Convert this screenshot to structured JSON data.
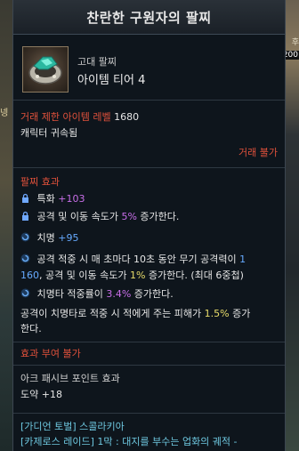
{
  "background": {
    "right_edge_text": "후",
    "right_edge_num": "200",
    "left_edge_label": "넹"
  },
  "tooltip": {
    "title": "찬란한 구원자의 팔찌",
    "grade": "고대 팔찌",
    "tier": "아이템 티어 4",
    "level_label": "거래 제한 아이템 레벨",
    "level_value": "1680",
    "bound": "캐릭터 귀속됨",
    "trade": "거래 불가",
    "effect_header": "팔찌 효과",
    "effects": {
      "e1_name": "특화",
      "e1_value": "+103",
      "e2_text": "공격 및 이동 속도가",
      "e2_value": "5%",
      "e2_suffix": "증가한다.",
      "e3_name": "치명",
      "e3_value": "+95",
      "e4_line1_a": "공격 적중 시 매 초마다 10초 동안 무기 공격력이",
      "e4_line1_b": "1",
      "e4_line2_a": "160",
      "e4_line2_b": ", 공격 및 이동 속도가",
      "e4_line2_c": "1%",
      "e4_line2_d": "증가한다. (최대 6중첩)",
      "e5_text": "치명타 적중률이",
      "e5_value": "3.4%",
      "e5_suffix": "증가한다.",
      "e6_line1_a": "공격이 치명타로 적중 시 적에게 주는 피해가",
      "e6_line1_b": "1.5%",
      "e6_line1_c": "증가",
      "e6_line2": "한다."
    },
    "imprint": "효과 부여 불가",
    "ark_header": "아크 패시브 포인트 효과",
    "ark_value": "도약 +18",
    "source1": "[가디언 토벌] 스콜라키아",
    "source2": "[카제로스 레이드] 1막 : 대지를 부수는 업화의 궤적 -"
  },
  "colors": {
    "red": "#e0513b",
    "purple": "#c86ee8",
    "blue": "#66aaff",
    "yellow": "#e8dc6a"
  }
}
